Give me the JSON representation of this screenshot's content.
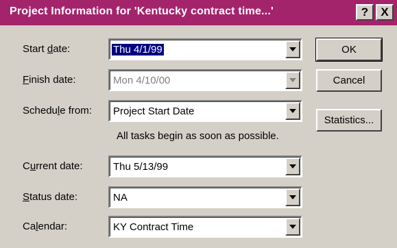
{
  "window": {
    "title": "Project Information for 'Kentucky contract time...'",
    "help_button": "?",
    "close_button": "X"
  },
  "fields": {
    "start_date": {
      "label": "Start date:",
      "value": "Thu 4/1/99"
    },
    "finish_date": {
      "label": "Finish date:",
      "value": "Mon 4/10/00"
    },
    "schedule_from": {
      "label": "Schedule from:",
      "value": "Project Start Date"
    },
    "current_date": {
      "label": "Current date:",
      "value": "Thu 5/13/99"
    },
    "status_date": {
      "label": "Status date:",
      "value": "NA"
    },
    "calendar": {
      "label": "Calendar:",
      "value": "KY Contract Time"
    }
  },
  "hint": "All tasks begin as soon as possible.",
  "buttons": {
    "ok": "OK",
    "cancel": "Cancel",
    "statistics": "Statistics..."
  },
  "colors": {
    "titlebar": "#a4246c",
    "dialog": "#d4d0c8",
    "selection": "#000080"
  }
}
